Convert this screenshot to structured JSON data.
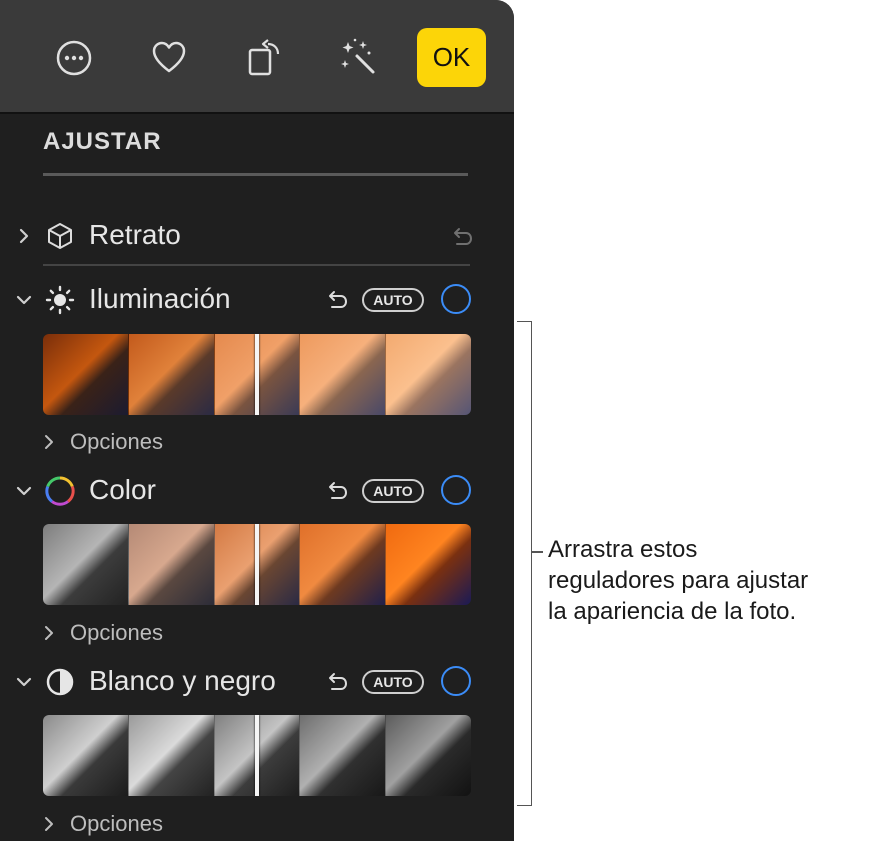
{
  "toolbar": {
    "buttons": [
      {
        "name": "more-icon"
      },
      {
        "name": "heart-icon"
      },
      {
        "name": "rotate-icon"
      },
      {
        "name": "magic-wand-icon"
      }
    ],
    "ok_label": "OK"
  },
  "sidebar": {
    "section_title": "AJUSTAR",
    "portrait": {
      "label": "Retrato",
      "icon": "cube-icon",
      "expanded": false
    },
    "adjustments": [
      {
        "label": "Iluminación",
        "icon": "sun-icon",
        "auto_label": "AUTO",
        "options_label": "Opciones",
        "expanded": true,
        "strip_style": "light"
      },
      {
        "label": "Color",
        "icon": "color-wheel-icon",
        "auto_label": "AUTO",
        "options_label": "Opciones",
        "expanded": true,
        "strip_style": "color"
      },
      {
        "label": "Blanco y negro",
        "icon": "half-circle-icon",
        "auto_label": "AUTO",
        "options_label": "Opciones",
        "expanded": true,
        "strip_style": "bw"
      }
    ]
  },
  "callout": {
    "text": "Arrastra estos\nreguladores para ajustar\nla apariencia de la foto."
  },
  "colors": {
    "accent": "#fcd508",
    "toggle": "#3b8cf7",
    "panel": "#1f1f1f",
    "toolbar": "#3a3a3a"
  }
}
